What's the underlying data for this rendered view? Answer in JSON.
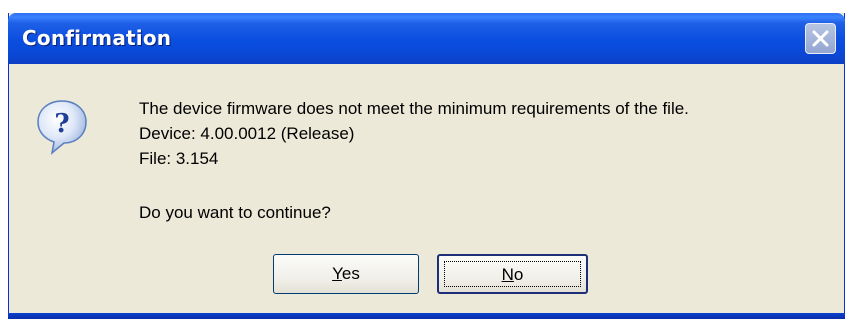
{
  "window": {
    "title": "Confirmation",
    "close_icon": "close-icon"
  },
  "dialog": {
    "icon": "question-icon",
    "message_lines": [
      "The device firmware does not meet the minimum requirements of the file.",
      "Device: 4.00.0012 (Release)",
      "File: 3.154"
    ],
    "question": "Do you want to continue?"
  },
  "buttons": {
    "yes_mnemonic": "Y",
    "yes_rest": "es",
    "no_mnemonic": "N",
    "no_rest": "o"
  },
  "colors": {
    "titlebar": "#0a4ee0",
    "dialog_bg": "#ece9d8",
    "close_button": "#93a6d2",
    "icon_blue": "#2a5fc4"
  }
}
